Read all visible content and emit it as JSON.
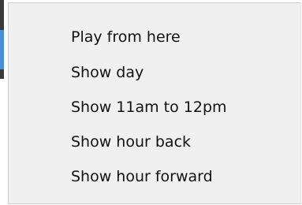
{
  "context_menu": {
    "items": [
      {
        "label": "Play from here"
      },
      {
        "label": "Show day"
      },
      {
        "label": "Show 11am to 12pm"
      },
      {
        "label": "Show hour back"
      },
      {
        "label": "Show hour forward"
      }
    ]
  },
  "colors": {
    "menu_background": "#f0f0f0",
    "menu_text": "#111111",
    "menu_border": "#cfcfcf",
    "window_accent": "#4a90d9"
  }
}
